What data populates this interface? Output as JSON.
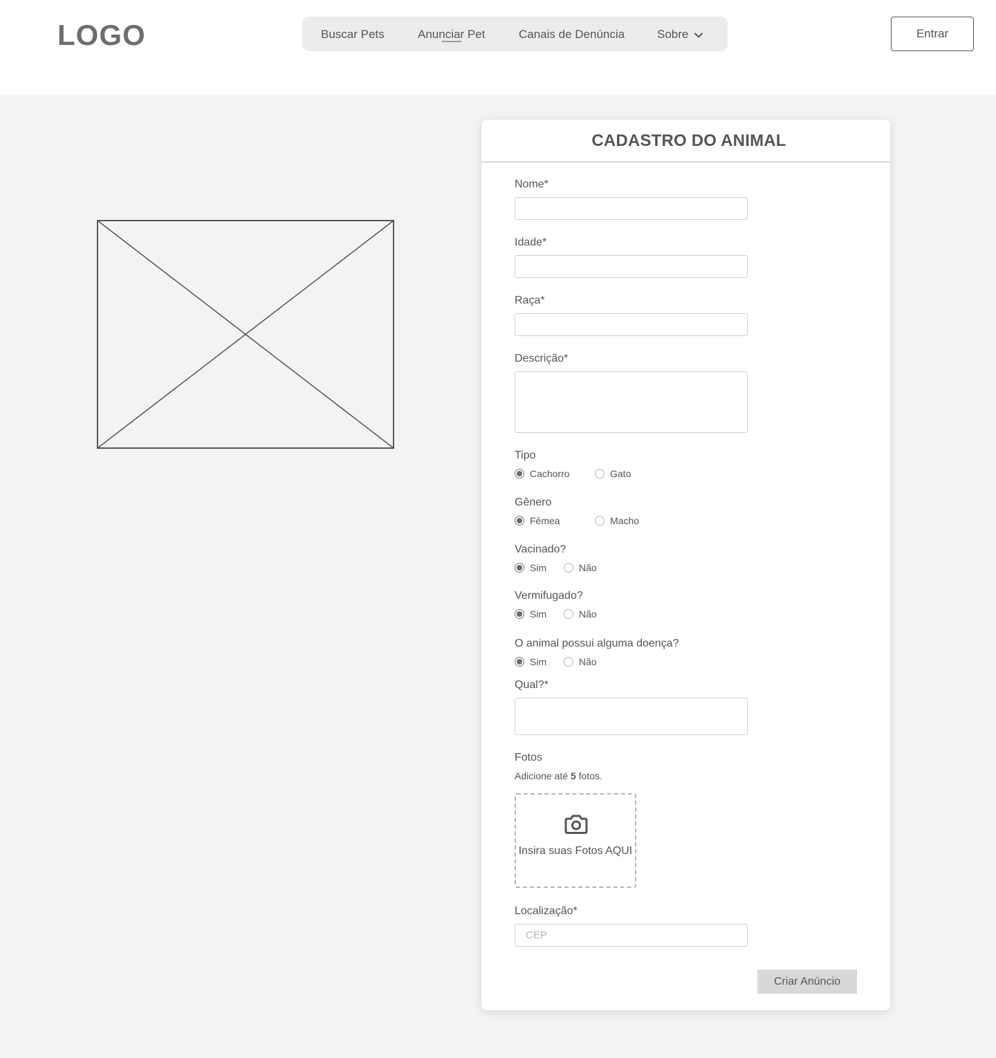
{
  "header": {
    "logo": "LOGO",
    "nav": [
      {
        "label": "Buscar Pets"
      },
      {
        "label": "Anunciar Pet"
      },
      {
        "label": "Canais de Denúncia"
      },
      {
        "label": "Sobre"
      }
    ],
    "login_label": "Entrar"
  },
  "form": {
    "title": "CADASTRO DO ANIMAL",
    "nome_label": "Nome*",
    "idade_label": "Idade*",
    "raca_label": "Raça*",
    "descricao_label": "Descrição*",
    "tipo": {
      "label": "Tipo",
      "options": [
        "Cachorro",
        "Gato"
      ],
      "selected": "Cachorro"
    },
    "genero": {
      "label": "Gênero",
      "options": [
        "Fêmea",
        "Macho"
      ],
      "selected": "Fêmea"
    },
    "vacinado": {
      "label": "Vacinado?",
      "options": [
        "Sim",
        "Não"
      ],
      "selected": "Sim"
    },
    "vermifugado": {
      "label": "Vermifugado?",
      "options": [
        "Sim",
        "Não"
      ],
      "selected": "Sim"
    },
    "doenca": {
      "label": "O animal possui alguma doença?",
      "options": [
        "Sim",
        "Não"
      ],
      "selected": "Sim"
    },
    "qual_label": "Qual?*",
    "fotos": {
      "label": "Fotos",
      "hint_prefix": "Adicione até ",
      "hint_count": "5",
      "hint_suffix": " fotos.",
      "upload_text": "Insira suas Fotos AQUI",
      "upload_icon": "camera-icon"
    },
    "localizacao_label": "Localização*",
    "cep_placeholder": "CEP",
    "submit_label": "Criar Anúncio"
  },
  "colors": {
    "page_bg": "#f3f3f3",
    "text": "#555555",
    "nav_bg": "#ececec",
    "button_bg": "#d8d8d8"
  }
}
